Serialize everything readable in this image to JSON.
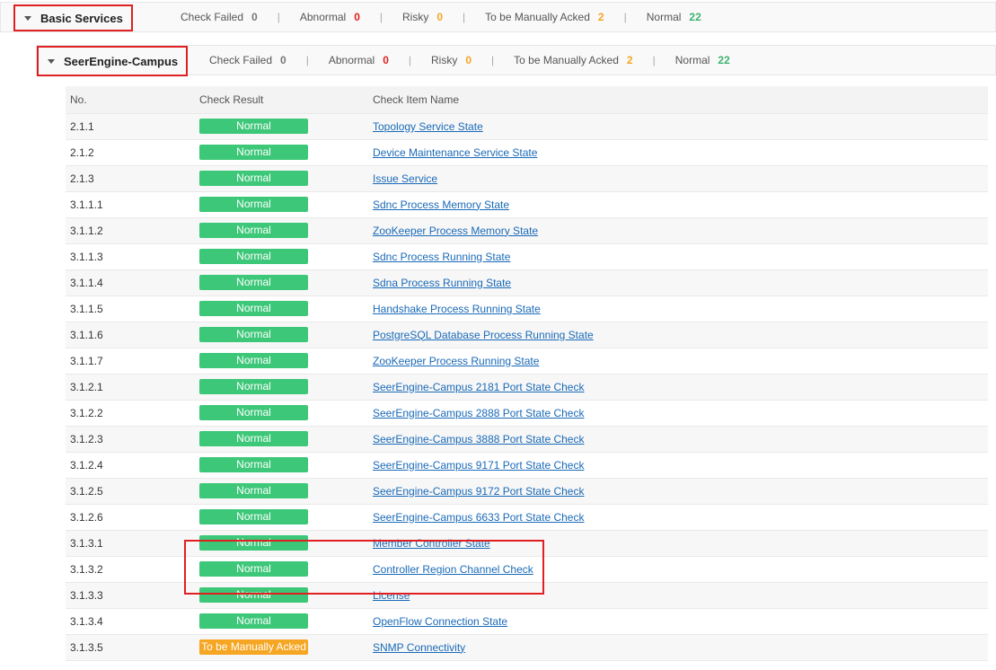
{
  "basic_services": {
    "title": "Basic Services",
    "stats": [
      {
        "label": "Check Failed",
        "value": "0",
        "tone": "gray"
      },
      {
        "label": "Abnormal",
        "value": "0",
        "tone": "red"
      },
      {
        "label": "Risky",
        "value": "0",
        "tone": "orange"
      },
      {
        "label": "To be Manually Acked",
        "value": "2",
        "tone": "orange"
      },
      {
        "label": "Normal",
        "value": "22",
        "tone": "green"
      }
    ]
  },
  "seerengine": {
    "title": "SeerEngine-Campus",
    "stats": [
      {
        "label": "Check Failed",
        "value": "0",
        "tone": "gray"
      },
      {
        "label": "Abnormal",
        "value": "0",
        "tone": "red"
      },
      {
        "label": "Risky",
        "value": "0",
        "tone": "orange"
      },
      {
        "label": "To be Manually Acked",
        "value": "2",
        "tone": "orange"
      },
      {
        "label": "Normal",
        "value": "22",
        "tone": "green"
      }
    ]
  },
  "table": {
    "headers": {
      "no": "No.",
      "result": "Check Result",
      "name": "Check Item Name"
    },
    "rows": [
      {
        "no": "2.1.1",
        "result": "Normal",
        "status": "normal",
        "name": "Topology Service State"
      },
      {
        "no": "2.1.2",
        "result": "Normal",
        "status": "normal",
        "name": "Device Maintenance Service State"
      },
      {
        "no": "2.1.3",
        "result": "Normal",
        "status": "normal",
        "name": "Issue Service"
      },
      {
        "no": "3.1.1.1",
        "result": "Normal",
        "status": "normal",
        "name": "Sdnc Process Memory State"
      },
      {
        "no": "3.1.1.2",
        "result": "Normal",
        "status": "normal",
        "name": "ZooKeeper Process Memory State"
      },
      {
        "no": "3.1.1.3",
        "result": "Normal",
        "status": "normal",
        "name": "Sdnc Process Running State"
      },
      {
        "no": "3.1.1.4",
        "result": "Normal",
        "status": "normal",
        "name": "Sdna Process Running State"
      },
      {
        "no": "3.1.1.5",
        "result": "Normal",
        "status": "normal",
        "name": "Handshake Process Running State"
      },
      {
        "no": "3.1.1.6",
        "result": "Normal",
        "status": "normal",
        "name": "PostgreSQL Database Process Running State"
      },
      {
        "no": "3.1.1.7",
        "result": "Normal",
        "status": "normal",
        "name": "ZooKeeper Process Running State"
      },
      {
        "no": "3.1.2.1",
        "result": "Normal",
        "status": "normal",
        "name": "SeerEngine-Campus 2181 Port State Check"
      },
      {
        "no": "3.1.2.2",
        "result": "Normal",
        "status": "normal",
        "name": "SeerEngine-Campus 2888 Port State Check"
      },
      {
        "no": "3.1.2.3",
        "result": "Normal",
        "status": "normal",
        "name": "SeerEngine-Campus 3888 Port State Check"
      },
      {
        "no": "3.1.2.4",
        "result": "Normal",
        "status": "normal",
        "name": "SeerEngine-Campus 9171 Port State Check"
      },
      {
        "no": "3.1.2.5",
        "result": "Normal",
        "status": "normal",
        "name": "SeerEngine-Campus 9172 Port State Check"
      },
      {
        "no": "3.1.2.6",
        "result": "Normal",
        "status": "normal",
        "name": "SeerEngine-Campus 6633 Port State Check"
      },
      {
        "no": "3.1.3.1",
        "result": "Normal",
        "status": "normal",
        "name": "Member Controller State"
      },
      {
        "no": "3.1.3.2",
        "result": "Normal",
        "status": "normal",
        "name": "Controller Region Channel Check"
      },
      {
        "no": "3.1.3.3",
        "result": "Normal",
        "status": "normal",
        "name": "License"
      },
      {
        "no": "3.1.3.4",
        "result": "Normal",
        "status": "normal",
        "name": "OpenFlow Connection State"
      },
      {
        "no": "3.1.3.5",
        "result": "To be Manually Acked",
        "status": "acked",
        "name": "SNMP Connectivity"
      }
    ]
  },
  "colors": {
    "normal": "#3dc778",
    "acked": "#f5a623",
    "highlight": "#e02020",
    "link": "#1a6ab8"
  }
}
